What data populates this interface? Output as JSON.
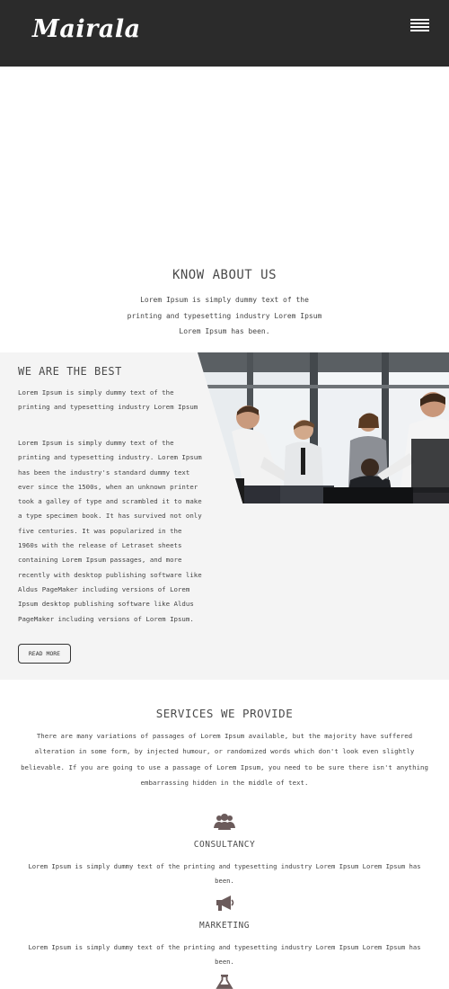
{
  "header": {
    "logo": "Mairala",
    "menu_icon": "hamburger-menu-icon",
    "background": "#2b2b2b"
  },
  "about": {
    "title": "KNOW ABOUT US",
    "text": "Lorem Ipsum is simply dummy text of the printing and typesetting industry Lorem Ipsum Lorem Ipsum has been."
  },
  "best": {
    "title": "WE ARE THE BEST",
    "paragraph1": "Lorem Ipsum is simply dummy text of the printing and typesetting industry Lorem Ipsum",
    "paragraph2": "Lorem Ipsum is simply dummy text of the printing and typesetting industry. Lorem Ipsum has been the industry's standard dummy text ever since the 1500s, when an unknown printer took a galley of type and scrambled it to make a type specimen book. It has survived not only five centuries. It was popularized in the 1960s with the release of Letraset sheets containing Lorem Ipsum passages, and more recently with desktop publishing software like Aldus PageMaker including versions of Lorem Ipsum desktop publishing software like Aldus PageMaker including versions of Lorem Ipsum.",
    "button": "READ MORE",
    "background": "#f4f4f4"
  },
  "services": {
    "title": "SERVICES WE PROVIDE",
    "intro": "There are many variations of passages of Lorem Ipsum available, but the majority have suffered alteration in some form, by injected humour, or randomized words which don't look even slightly believable. If you are going to use a passage of Lorem Ipsum, you need to be sure there isn't anything embarrassing hidden in the middle of text.",
    "icon_color": "#6b5b5b",
    "items": [
      {
        "icon": "users-icon",
        "title": "CONSULTANCY",
        "text": "Lorem Ipsum is simply dummy text of the printing and typesetting industry Lorem Ipsum Lorem Ipsum has been."
      },
      {
        "icon": "megaphone-icon",
        "title": "MARKETING",
        "text": "Lorem Ipsum is simply dummy text of the printing and typesetting industry Lorem Ipsum Lorem Ipsum has been."
      },
      {
        "icon": "flask-icon",
        "title": "",
        "text": ""
      }
    ]
  }
}
